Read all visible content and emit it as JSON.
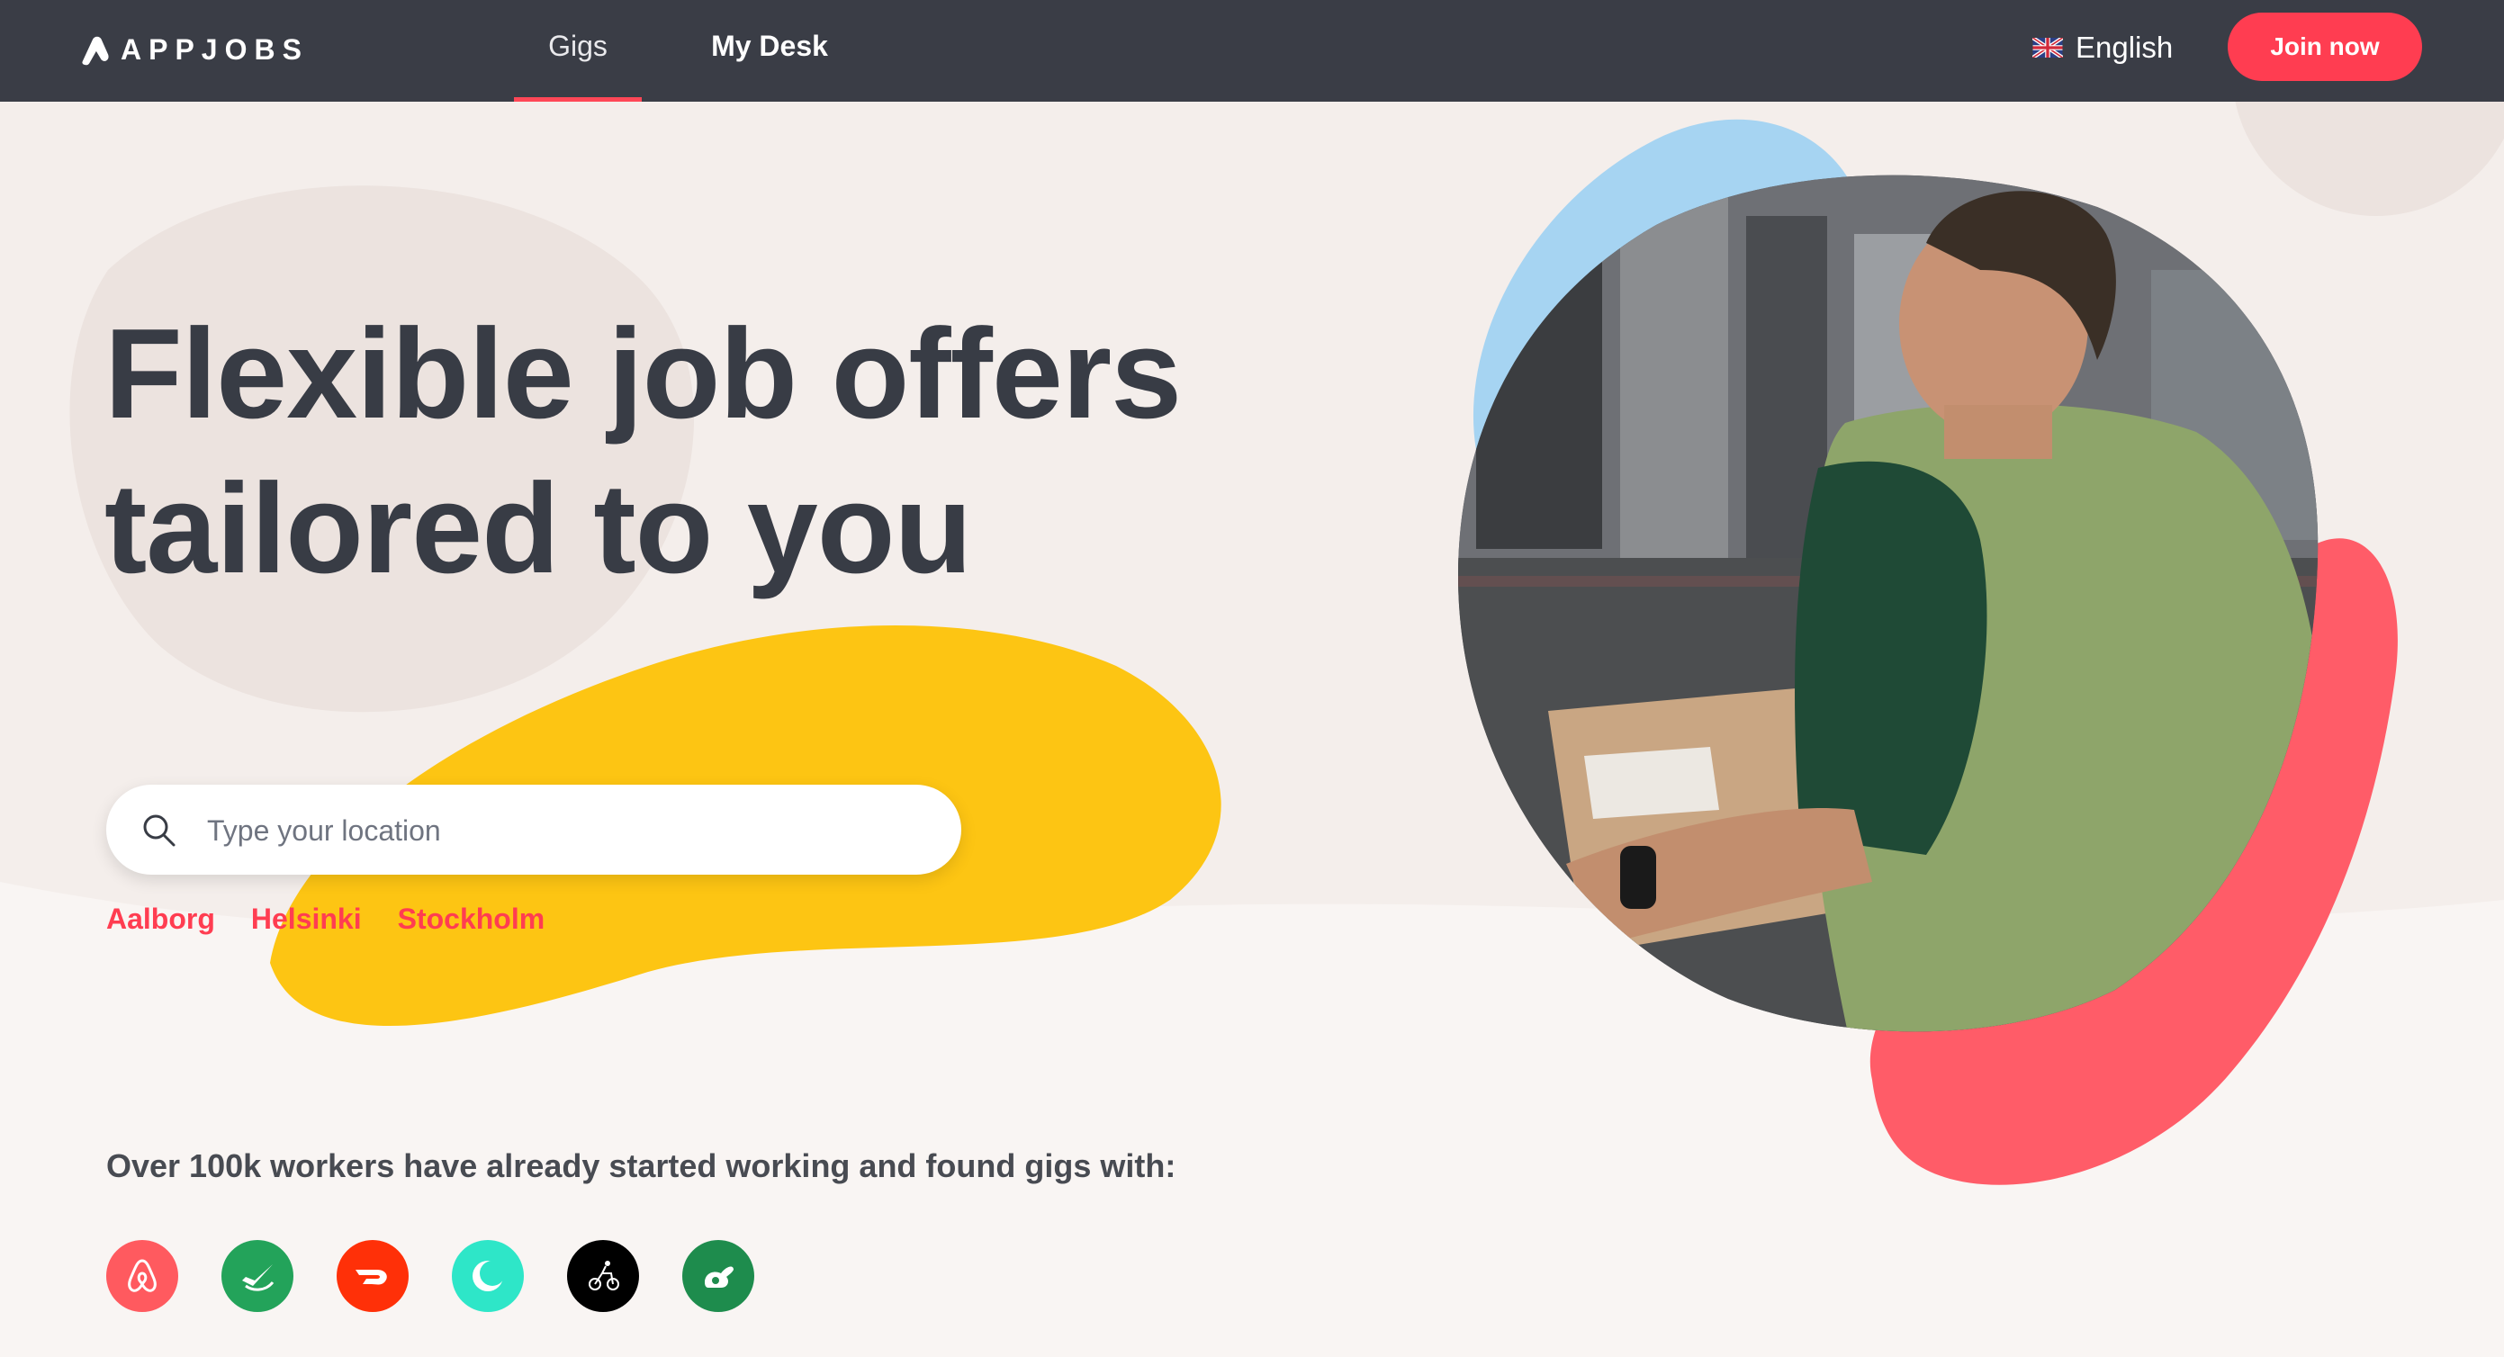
{
  "nav": {
    "logo_text": "APPJOBS",
    "gigs": "Gigs",
    "my_desk": "My Desk",
    "language": "English",
    "join": "Join now"
  },
  "hero": {
    "title_line1": "Flexible job offers",
    "title_line2": "tailored to you",
    "search_placeholder": "Type your location",
    "cities": [
      "Aalborg",
      "Helsinki",
      "Stockholm"
    ]
  },
  "workers_text": "Over 100k workers have already started working and found gigs with:",
  "partners": [
    {
      "icon": "airbnb-icon",
      "color": "#ff5a5f"
    },
    {
      "icon": "taskrabbit-like-green-icon",
      "color": "#23a35a"
    },
    {
      "icon": "doordash-icon",
      "color": "#ff3008"
    },
    {
      "icon": "crescent-turquoise-icon",
      "color": "#2ee6c8"
    },
    {
      "icon": "postmates-icon",
      "color": "#000000"
    },
    {
      "icon": "taskrabbit-icon",
      "color": "#1e8c4d"
    }
  ],
  "colors": {
    "nav_bg": "#3a3d46",
    "accent": "#ff3d51",
    "page_bg": "#f4eeeb",
    "yellow_blob": "#fdc513",
    "blue_blob": "#a6d4f2",
    "red_blob": "#ff5c68"
  }
}
